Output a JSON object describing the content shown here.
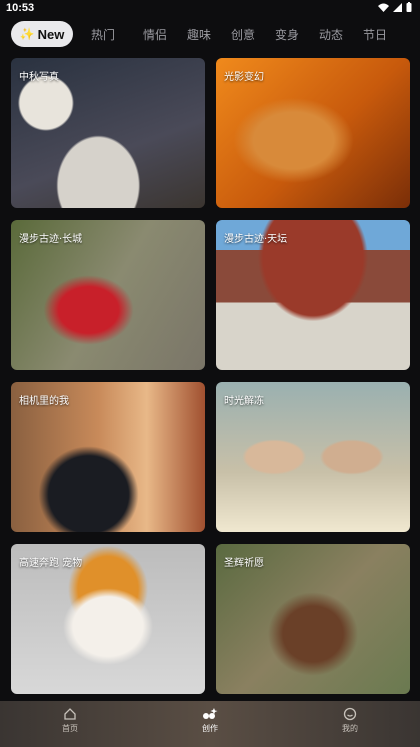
{
  "status": {
    "time": "10:53"
  },
  "tabs": {
    "new_label": "New",
    "items": [
      "热门",
      "情侣",
      "趣味",
      "创意",
      "变身",
      "动态",
      "节日"
    ]
  },
  "cards": [
    {
      "label": "中秋写真"
    },
    {
      "label": "光影变幻"
    },
    {
      "label": "漫步古迹·长城"
    },
    {
      "label": "漫步古迹·天坛"
    },
    {
      "label": "相机里的我"
    },
    {
      "label": "时光解冻"
    },
    {
      "label": "高速奔跑 宠物"
    },
    {
      "label": "圣辉祈愿"
    }
  ],
  "nav": [
    {
      "label": "首页",
      "icon": "home-icon"
    },
    {
      "label": "创作",
      "icon": "create-icon"
    },
    {
      "label": "我的",
      "icon": "profile-icon"
    }
  ]
}
